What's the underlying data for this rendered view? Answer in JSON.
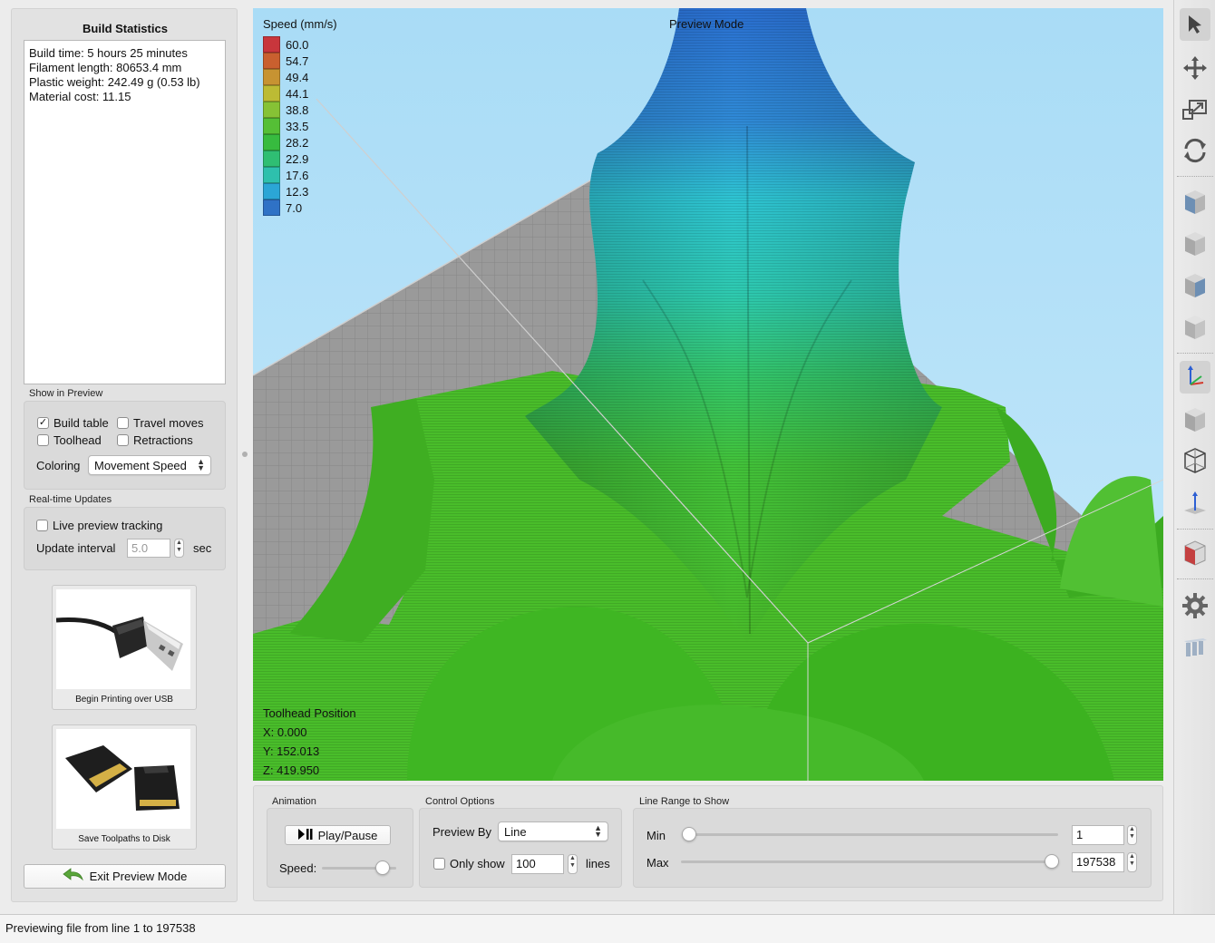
{
  "left_panel": {
    "title": "Build Statistics",
    "stats": [
      "Build time: 5 hours 25 minutes",
      "Filament length: 80653.4 mm",
      "Plastic weight: 242.49 g (0.53 lb)",
      "Material cost: 11.15"
    ],
    "show_in_preview": {
      "label": "Show in Preview",
      "build_table": {
        "label": "Build table",
        "checked": true
      },
      "travel_moves": {
        "label": "Travel moves",
        "checked": false
      },
      "toolhead": {
        "label": "Toolhead",
        "checked": false
      },
      "retractions": {
        "label": "Retractions",
        "checked": false
      },
      "coloring_label": "Coloring",
      "coloring_value": "Movement Speed"
    },
    "realtime": {
      "label": "Real-time Updates",
      "live_tracking": {
        "label": "Live preview tracking",
        "checked": false
      },
      "interval_label": "Update interval",
      "interval_value": "5.0",
      "interval_unit": "sec"
    },
    "usb_button": {
      "caption": "Begin Printing over USB",
      "icon": "usb-cable-icon"
    },
    "sd_button": {
      "caption": "Save Toolpaths to Disk",
      "icon": "sd-card-icon"
    },
    "exit_button": {
      "label": "Exit Preview Mode",
      "icon": "back-arrow-icon"
    }
  },
  "viewport": {
    "mode_label": "Preview Mode",
    "legend_title": "Speed (mm/s)",
    "legend": [
      {
        "value": "60.0",
        "color": "#c8363c"
      },
      {
        "value": "54.7",
        "color": "#c9602f"
      },
      {
        "value": "49.4",
        "color": "#c79332"
      },
      {
        "value": "44.1",
        "color": "#bcbb34"
      },
      {
        "value": "38.8",
        "color": "#86c235"
      },
      {
        "value": "33.5",
        "color": "#55bf36"
      },
      {
        "value": "28.2",
        "color": "#37bb3f"
      },
      {
        "value": "22.9",
        "color": "#2fbe73"
      },
      {
        "value": "17.6",
        "color": "#2ec0ad"
      },
      {
        "value": "12.3",
        "color": "#2ba6d6"
      },
      {
        "value": "7.0",
        "color": "#2f72c6"
      }
    ],
    "toolhead": {
      "title": "Toolhead Position",
      "x": "X: 0.000",
      "y": "Y: 152.013",
      "z": "Z: 419.950"
    }
  },
  "controls": {
    "animation": {
      "label": "Animation",
      "play_pause": "Play/Pause",
      "speed_label": "Speed:",
      "speed_level": 0.82
    },
    "control_options": {
      "label": "Control Options",
      "preview_by_label": "Preview By",
      "preview_by_value": "Line",
      "only_show_label": "Only show",
      "only_show_checked": false,
      "only_show_value": "100",
      "lines_label": "lines"
    },
    "line_range": {
      "label": "Line Range to Show",
      "min_label": "Min",
      "min_value": "1",
      "max_label": "Max",
      "max_value": "197538"
    }
  },
  "toolbar": [
    {
      "name": "select-tool-icon",
      "active": true
    },
    {
      "name": "move-tool-icon",
      "active": false
    },
    {
      "name": "scale-tool-icon",
      "active": false
    },
    {
      "name": "rotate-tool-icon",
      "active": false
    },
    {
      "name": "view-front-icon",
      "active": false
    },
    {
      "name": "view-back-icon",
      "active": false
    },
    {
      "name": "view-left-icon",
      "active": false
    },
    {
      "name": "view-right-icon",
      "active": false
    },
    {
      "name": "axes-icon",
      "active": true
    },
    {
      "name": "solid-view-icon",
      "active": false
    },
    {
      "name": "wireframe-view-icon",
      "active": false
    },
    {
      "name": "normals-icon",
      "active": false
    },
    {
      "name": "cross-section-icon",
      "active": false
    },
    {
      "name": "settings-gear-icon",
      "active": false
    },
    {
      "name": "supports-icon",
      "active": false
    }
  ],
  "status_bar": "Previewing file from line 1 to 197538"
}
